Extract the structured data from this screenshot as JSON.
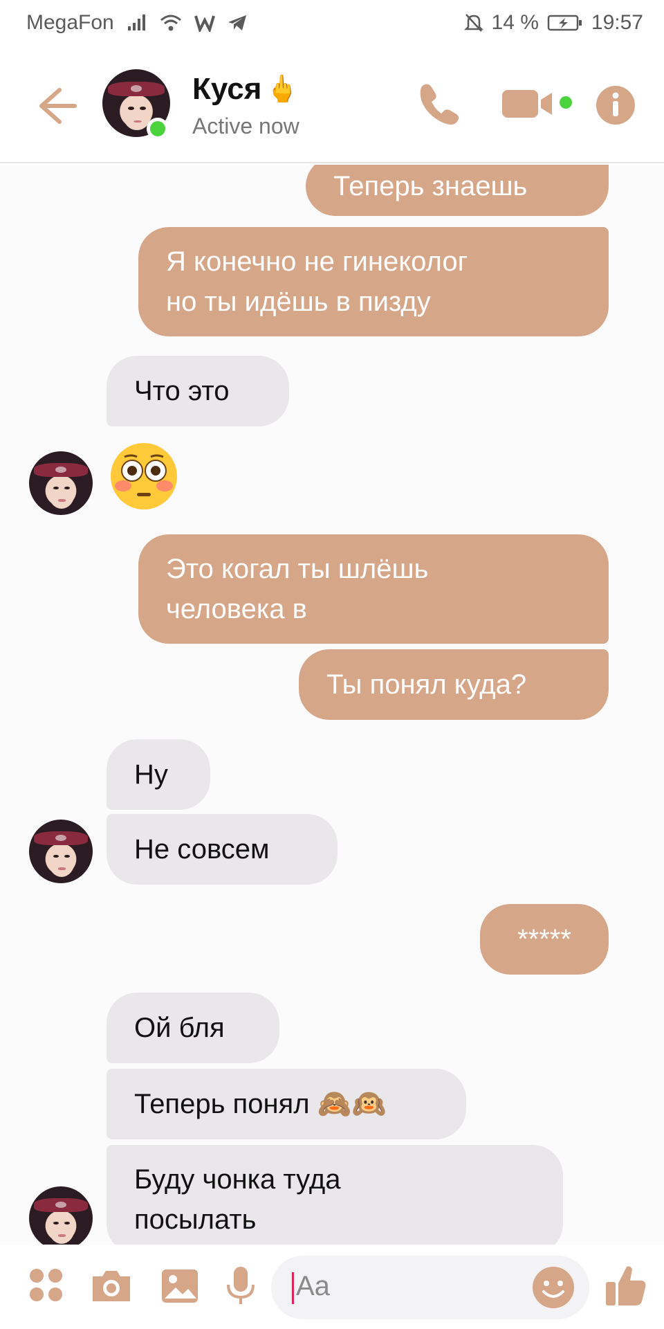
{
  "status_bar": {
    "carrier": "MegaFon",
    "battery": "14 %",
    "time": "19:57"
  },
  "header": {
    "contact_name": "Куся",
    "contact_emoji": "🖕",
    "presence": "Active now"
  },
  "messages": [
    {
      "side": "out",
      "text": "Теперь знаешь"
    },
    {
      "side": "out",
      "text": "Я конечно не гинеколог\nно ты идёшь в пизду"
    },
    {
      "side": "in",
      "text": "Что это"
    },
    {
      "side": "in",
      "text": "😳",
      "type": "emoji"
    },
    {
      "side": "out",
      "text": "Это когал ты шлёшь\nчеловека в"
    },
    {
      "side": "out",
      "text": "Ты понял куда?"
    },
    {
      "side": "in",
      "text": "Ну"
    },
    {
      "side": "in",
      "text": "Не совсем"
    },
    {
      "side": "out",
      "text": "*****"
    },
    {
      "side": "in",
      "text": "Ой бля"
    },
    {
      "side": "in",
      "text": "Теперь понял 🙈🙉"
    },
    {
      "side": "in",
      "text": "Буду чонка туда\nпосылать"
    }
  ],
  "composer": {
    "placeholder": "Aa"
  },
  "colors": {
    "accent": "#d6a688",
    "incoming_bubble": "#e9e7ea",
    "online": "#4cd23d"
  },
  "icons": [
    "back-arrow-icon",
    "phone-icon",
    "video-camera-icon",
    "info-icon",
    "apps-icon",
    "camera-icon",
    "gallery-icon",
    "microphone-icon",
    "emoji-icon",
    "thumbs-up-icon"
  ]
}
